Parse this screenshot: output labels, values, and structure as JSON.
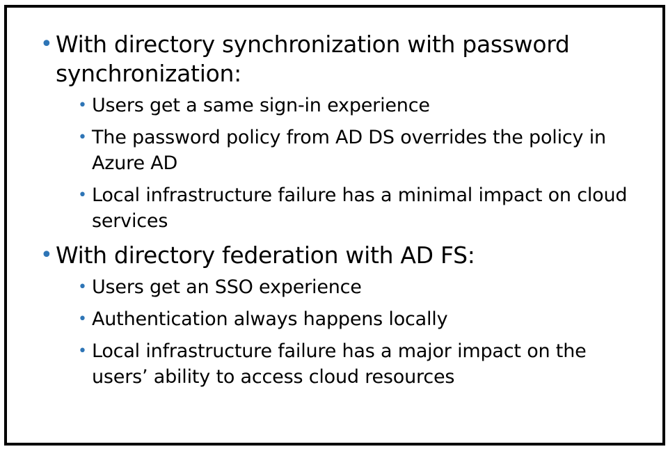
{
  "colors": {
    "bullet": "#2e75b6",
    "text": "#000000",
    "border": "#000000"
  },
  "sections": [
    {
      "heading": "With directory synchronization with password synchronization:",
      "items": [
        "Users get a same sign-in experience",
        "The password policy from AD DS overrides the policy in Azure AD",
        "Local infrastructure failure has a minimal impact on cloud services"
      ]
    },
    {
      "heading": "With directory federation with AD FS:",
      "items": [
        "Users get an SSO experience",
        "Authentication always happens locally",
        "Local infrastructure failure has a major impact on the users’ ability to access cloud resources"
      ]
    }
  ]
}
